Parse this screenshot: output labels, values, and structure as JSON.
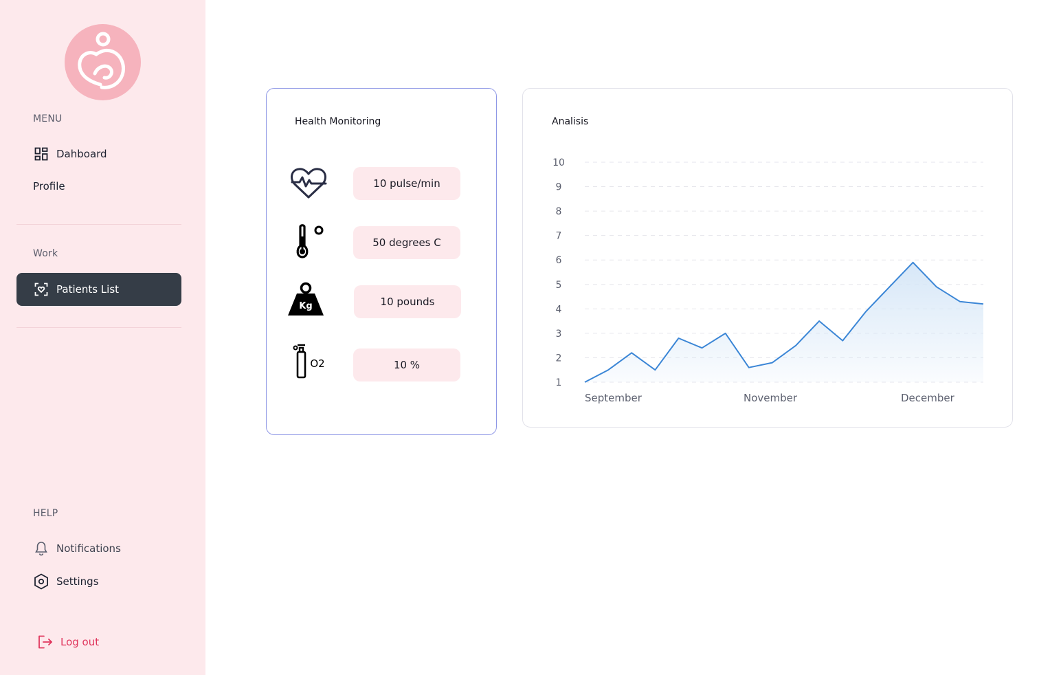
{
  "sidebar": {
    "menu_title": "MENU",
    "items": [
      {
        "label": "Dahboard",
        "icon": "dashboard-grid-icon"
      },
      {
        "label": "Profile"
      }
    ],
    "work_title": "Work",
    "work_items": [
      {
        "label": "Patients List",
        "icon": "patient-scan-icon",
        "active": true
      }
    ],
    "help_title": "HELP",
    "help_items": [
      {
        "label": "Notifications",
        "icon": "bell-icon"
      },
      {
        "label": "Settings",
        "icon": "hexagon-settings-icon"
      }
    ],
    "logout_label": "Log out"
  },
  "health": {
    "title": "Health Monitoring",
    "metrics": [
      {
        "icon": "heartbeat-icon",
        "value": "10 pulse/min"
      },
      {
        "icon": "thermometer-icon",
        "value": "50 degrees C"
      },
      {
        "icon": "weight-kg-icon",
        "icon_text": "Kg",
        "value": "10 pounds"
      },
      {
        "icon": "oxygen-tank-icon",
        "icon_text": "O2",
        "value": "10 %"
      }
    ]
  },
  "analysis": {
    "title": "Analisis"
  },
  "chart_data": {
    "type": "area",
    "title": "Analisis",
    "y_ticks": [
      1,
      2,
      3,
      4,
      5,
      6,
      7,
      8,
      9,
      10
    ],
    "ylim": [
      1,
      10
    ],
    "x_labels": [
      "September",
      "November",
      "December"
    ],
    "series": [
      {
        "values": [
          1.0,
          1.5,
          2.2,
          1.5,
          2.8,
          2.4,
          3.0,
          1.6,
          1.8,
          2.5,
          3.5,
          2.7,
          3.9,
          4.9,
          5.9,
          4.9,
          4.3,
          4.2
        ]
      }
    ],
    "grid": true,
    "colors": {
      "line": "#3b86d6",
      "fill": "#d5e6f7"
    }
  },
  "colors": {
    "sidebar_bg": "#fde9ec",
    "active_bg": "#353d47",
    "accent_pink": "#f6b3bd",
    "logout": "#e0365d"
  }
}
